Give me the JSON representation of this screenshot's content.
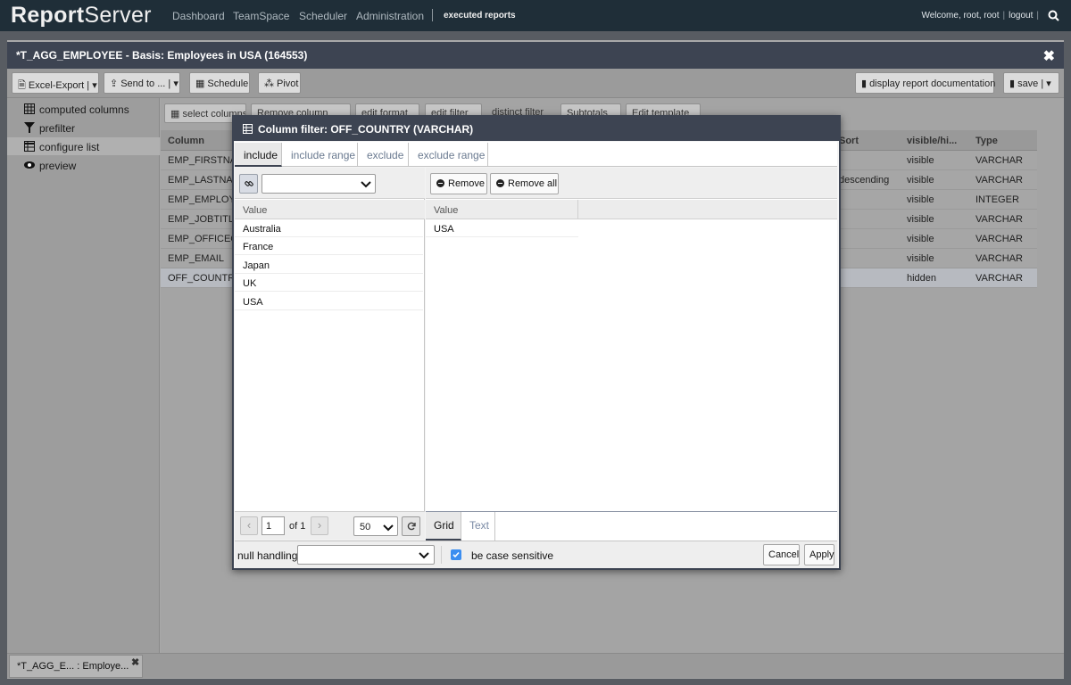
{
  "nav": {
    "brand_bold": "Report",
    "brand_rest": "Server",
    "links": [
      "Dashboard",
      "TeamSpace",
      "Scheduler",
      "Administration"
    ],
    "executed_reports": "executed reports",
    "welcome": "Welcome, root, root",
    "logout": "logout"
  },
  "report": {
    "title": "*T_AGG_EMPLOYEE - Basis: Employees in USA (164553)",
    "toolbar": {
      "excel_export": "Excel-Export",
      "send_to": "Send to ...",
      "schedule": "Schedule",
      "pivot": "Pivot",
      "display_doc": "display report documentation",
      "save": "save"
    },
    "sidebar": [
      {
        "label": "computed columns",
        "icon": "grid-icon"
      },
      {
        "label": "prefilter",
        "icon": "filter-icon"
      },
      {
        "label": "configure list",
        "icon": "table-edit-icon"
      },
      {
        "label": "preview",
        "icon": "eye-icon"
      }
    ],
    "main_toolbar": {
      "select_columns": "select columns",
      "remove_column": "Remove column",
      "edit_format": "edit format",
      "edit_filter": "edit filter",
      "distinct_filter": "distinct filter",
      "subtotals": "Subtotals",
      "edit_template": "Edit template"
    },
    "columns_table": {
      "headers": {
        "column": "Column",
        "sort": "Sort",
        "visible": "visible/hi...",
        "type": "Type"
      },
      "rows": [
        {
          "column": "EMP_FIRSTNA",
          "sort": "",
          "visible": "visible",
          "type": "VARCHAR"
        },
        {
          "column": "EMP_LASTNAM",
          "sort": "descending",
          "visible": "visible",
          "type": "VARCHAR"
        },
        {
          "column": "EMP_EMPLOY",
          "sort": "",
          "visible": "visible",
          "type": "INTEGER"
        },
        {
          "column": "EMP_JOBTITLI",
          "sort": "",
          "visible": "visible",
          "type": "VARCHAR"
        },
        {
          "column": "EMP_OFFICEC",
          "sort": "",
          "visible": "visible",
          "type": "VARCHAR"
        },
        {
          "column": "EMP_EMAIL",
          "sort": "",
          "visible": "visible",
          "type": "VARCHAR"
        },
        {
          "column": "OFF_COUNTR",
          "sort": "",
          "visible": "hidden",
          "type": "VARCHAR"
        }
      ]
    },
    "bottom_tab": "*T_AGG_E... : Employe..."
  },
  "dialog": {
    "title": "Column filter: OFF_COUNTRY (VARCHAR)",
    "tabs": [
      "include",
      "include range",
      "exclude",
      "exclude range"
    ],
    "active_tab": "include",
    "left": {
      "header": "Value",
      "values": [
        "Australia",
        "France",
        "Japan",
        "UK",
        "USA"
      ],
      "page": "1",
      "of_pages": "of 1",
      "page_size": "50"
    },
    "right": {
      "remove": "Remove",
      "remove_all": "Remove all",
      "header": "Value",
      "values": [
        "USA"
      ],
      "bottom_tabs": [
        "Grid",
        "Text"
      ]
    },
    "footer": {
      "null_handling": "null handling",
      "case_sensitive": "be case sensitive",
      "cancel": "Cancel",
      "apply": "Apply"
    }
  },
  "colors": {
    "nav_bg": "#1f2e38",
    "title_bar": "#3d4452",
    "checkbox": "#3b8ef0"
  }
}
